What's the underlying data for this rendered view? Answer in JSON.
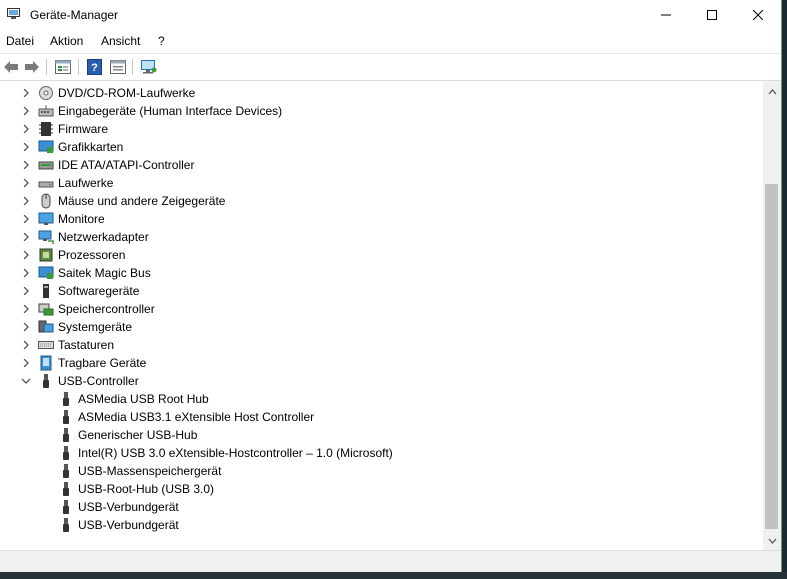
{
  "window": {
    "title": "Geräte-Manager"
  },
  "menu": [
    "Datei",
    "Aktion",
    "Ansicht",
    "?"
  ],
  "toolbar_icons": [
    "back-icon",
    "forward-icon",
    "device-view-icon",
    "help-icon",
    "properties-icon",
    "monitor-scan-icon"
  ],
  "tree": {
    "categories": [
      {
        "label": "DVD/CD-ROM-Laufwerke",
        "icon": "dvd-drive-icon"
      },
      {
        "label": "Eingabegeräte (Human Interface Devices)",
        "icon": "hid-icon"
      },
      {
        "label": "Firmware",
        "icon": "firmware-icon"
      },
      {
        "label": "Grafikkarten",
        "icon": "display-adapter-icon"
      },
      {
        "label": "IDE ATA/ATAPI-Controller",
        "icon": "ide-controller-icon"
      },
      {
        "label": "Laufwerke",
        "icon": "disk-drive-icon"
      },
      {
        "label": "Mäuse und andere Zeigegeräte",
        "icon": "mouse-icon"
      },
      {
        "label": "Monitore",
        "icon": "monitor-icon"
      },
      {
        "label": "Netzwerkadapter",
        "icon": "network-adapter-icon"
      },
      {
        "label": "Prozessoren",
        "icon": "processor-icon"
      },
      {
        "label": "Saitek Magic Bus",
        "icon": "saitek-bus-icon"
      },
      {
        "label": "Softwaregeräte",
        "icon": "software-device-icon"
      },
      {
        "label": "Speichercontroller",
        "icon": "storage-controller-icon"
      },
      {
        "label": "Systemgeräte",
        "icon": "system-device-icon"
      },
      {
        "label": "Tastaturen",
        "icon": "keyboard-icon"
      },
      {
        "label": "Tragbare Geräte",
        "icon": "portable-device-icon"
      },
      {
        "label": "USB-Controller",
        "icon": "usb-icon",
        "expanded": true
      }
    ],
    "usb_children": [
      "ASMedia USB Root Hub",
      "ASMedia USB3.1 eXtensible Host Controller",
      "Generischer USB-Hub",
      "Intel(R) USB 3.0 eXtensible-Hostcontroller – 1.0 (Microsoft)",
      "USB-Massenspeichergerät",
      "USB-Root-Hub (USB 3.0)",
      "USB-Verbundgerät",
      "USB-Verbundgerät"
    ]
  },
  "colors": {
    "accent": "#1e88c8",
    "thumb": "#c2c2c2"
  }
}
